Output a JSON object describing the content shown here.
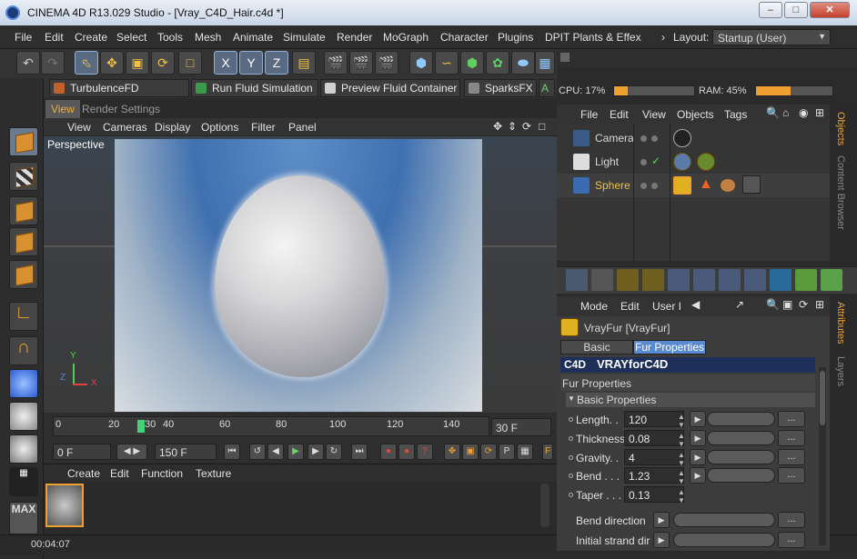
{
  "window": {
    "title": "CINEMA 4D R13.029 Studio - [Vray_C4D_Hair.c4d *]",
    "minimize_label": "–",
    "maximize_label": "□",
    "close_label": "✕"
  },
  "menubar": {
    "items": [
      "File",
      "Edit",
      "Create",
      "Select",
      "Tools",
      "Mesh",
      "Animate",
      "Simulate",
      "Render",
      "MoGraph",
      "Character",
      "Plugins",
      "DPIT Plants & Effex"
    ],
    "overflow": "›",
    "layout_label": "Layout:",
    "layout_value": "Startup (User)"
  },
  "toolbar": {
    "icons": [
      "undo-icon",
      "redo-icon",
      "live-selection-icon",
      "move-icon",
      "scale-icon",
      "rotate-icon",
      "recent-tools-icon",
      "x-axis-icon",
      "y-axis-icon",
      "z-axis-icon",
      "world-coordinates-icon",
      "render-view-icon",
      "render-picture-viewer-icon",
      "edit-render-settings-icon",
      "cube-icon",
      "spline-icon",
      "nurbs-icon",
      "array-icon",
      "deformer-icon",
      "floor-icon"
    ],
    "axis_labels": [
      "X",
      "Y",
      "Z"
    ]
  },
  "plugins": {
    "buttons": [
      "TurbulenceFD Container",
      "Run Fluid Simulation",
      "Preview Fluid Container",
      "SparksFX"
    ]
  },
  "viewport": {
    "tabs": [
      "View",
      "Render Settings"
    ],
    "menu": [
      "View",
      "Cameras",
      "Display",
      "Options",
      "Filter",
      "Panel"
    ],
    "label": "Perspective",
    "axis_x": "X",
    "axis_y": "Y",
    "axis_z": "Z"
  },
  "timeline": {
    "ticks": [
      "0",
      "20",
      "30",
      "40",
      "60",
      "80",
      "100",
      "120",
      "140"
    ],
    "current_frame": "30 F",
    "start_field": "0 F",
    "end_field": "150 F"
  },
  "materials": {
    "menu": [
      "Create",
      "Edit",
      "Function",
      "Texture"
    ]
  },
  "status": {
    "time": "00:04:07"
  },
  "perf": {
    "cpu_label": "CPU: 17%",
    "cpu_fraction": 0.17,
    "ram_label": "RAM: 45%",
    "ram_fraction": 0.45
  },
  "objects_manager": {
    "menu": [
      "File",
      "Edit",
      "View",
      "Objects",
      "Tags"
    ],
    "objects": [
      {
        "name": "Camera",
        "selected": false
      },
      {
        "name": "Light",
        "selected": false
      },
      {
        "name": "Sphere",
        "selected": true
      }
    ],
    "side_tabs": [
      "Objects",
      "Content Browser"
    ]
  },
  "attributes": {
    "menu": [
      "Mode",
      "Edit",
      "User I"
    ],
    "object_title": "VrayFur [VrayFur]",
    "tabs": [
      "Basic",
      "Fur Properties"
    ],
    "active_tab": "Fur Properties",
    "banner": "VRAYforC4D",
    "banner_logo": "C4D",
    "section": "Fur Properties",
    "group": "Basic Properties",
    "fields": [
      {
        "label": "Length. .",
        "value": "120"
      },
      {
        "label": "Thickness",
        "value": "0.08"
      },
      {
        "label": "Gravity. .",
        "value": "4"
      },
      {
        "label": "Bend . . .",
        "value": "1.23"
      },
      {
        "label": "Taper . . .",
        "value": "0.13"
      }
    ],
    "extra_rows": [
      "Bend direction",
      "Initial strand dir"
    ],
    "side_tabs": [
      "Attributes",
      "Layers"
    ],
    "dots_label": "..."
  },
  "colors": {
    "accent": "#f0a030",
    "selected_object": "#f0c040",
    "active_tab": "#5a8ad0",
    "banner_bg": "#1e2f5a"
  }
}
